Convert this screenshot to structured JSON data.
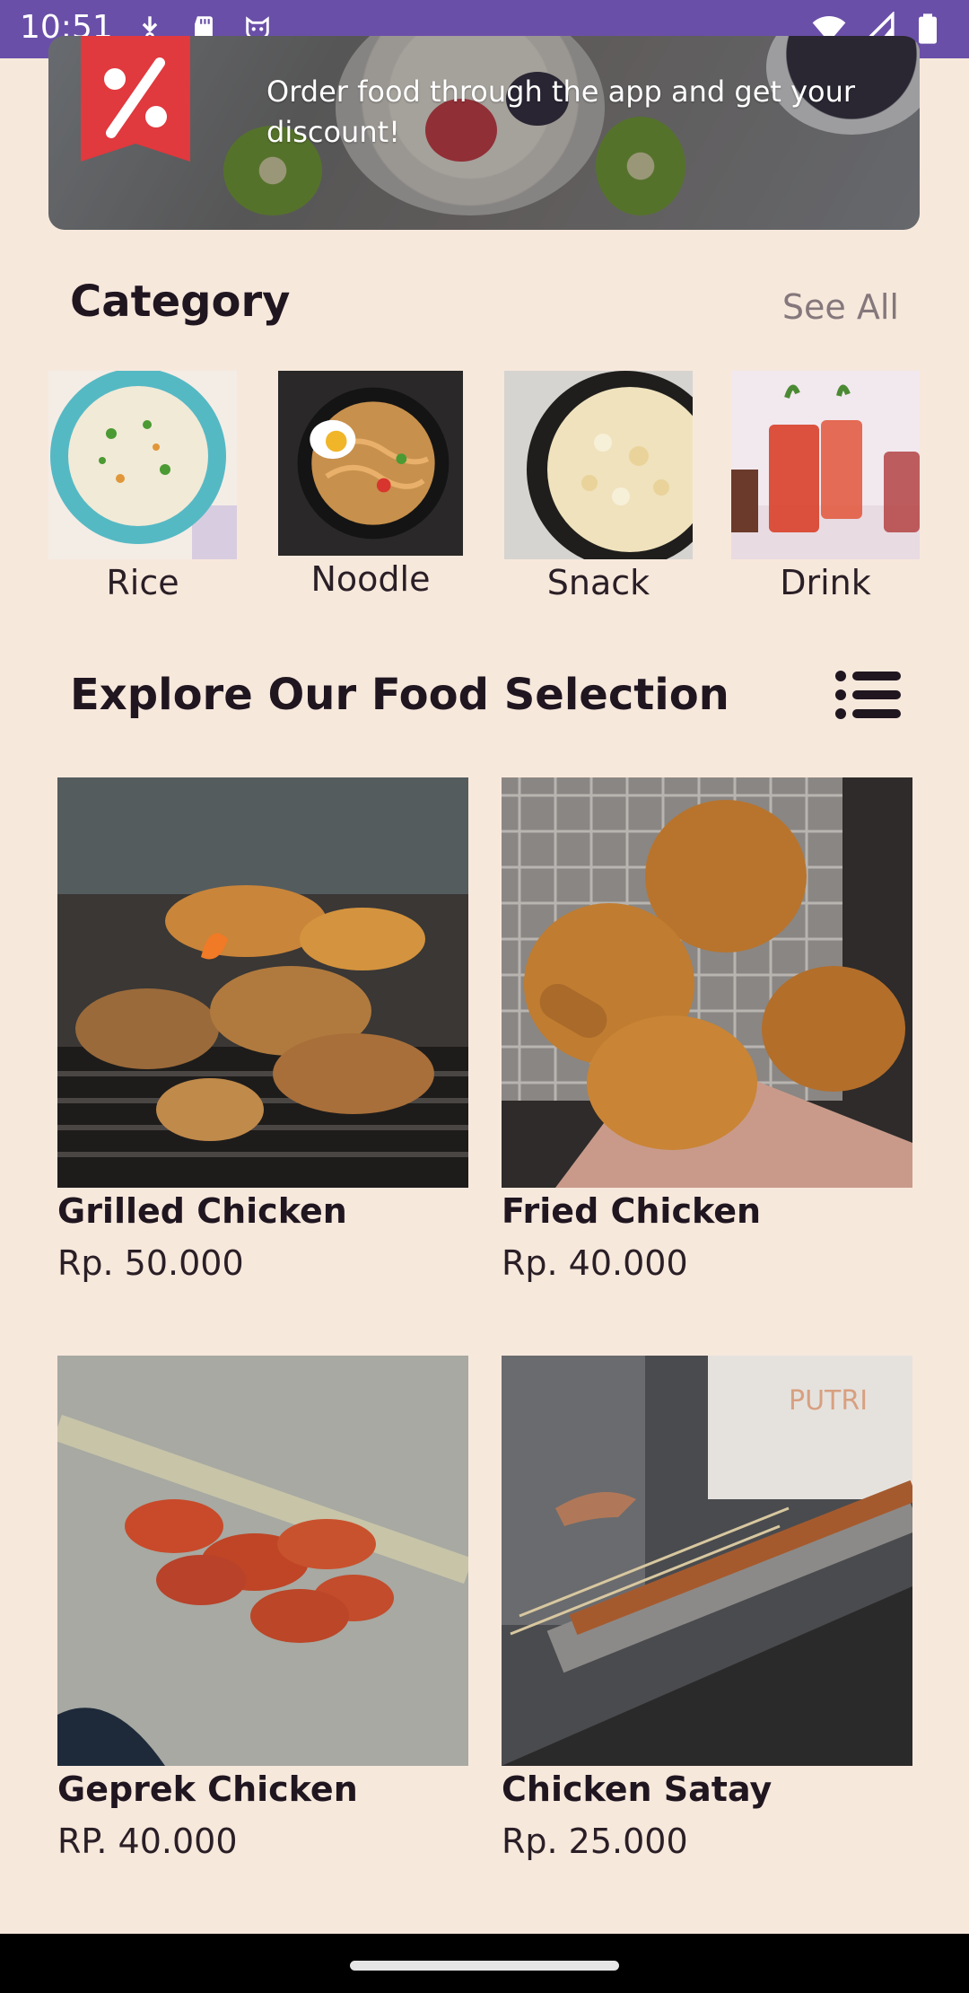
{
  "status_bar": {
    "time": "10:51",
    "icons": [
      "download-icon",
      "sd-card-icon",
      "cat-face-icon",
      "wifi-icon",
      "cellular-signal-icon",
      "battery-icon"
    ],
    "background": "#6a4fa8"
  },
  "banner": {
    "badge_icon": "percent-discount-icon",
    "text": "Order food through the app and get your discount!"
  },
  "category_section": {
    "title": "Category",
    "see_all": "See All",
    "items": [
      {
        "label": "Rice",
        "icon": "rice-image"
      },
      {
        "label": "Noodle",
        "icon": "noodle-image"
      },
      {
        "label": "Snack",
        "icon": "snack-image"
      },
      {
        "label": "Drink",
        "icon": "drink-image"
      }
    ]
  },
  "food_section": {
    "title": "Explore Our Food Selection",
    "view_toggle_icon": "list-view-icon",
    "items": [
      {
        "name": "Grilled Chicken",
        "price": "Rp. 50.000"
      },
      {
        "name": "Fried Chicken",
        "price": "Rp. 40.000"
      },
      {
        "name": "Geprek Chicken",
        "price": "RP. 40.000"
      },
      {
        "name": "Chicken Satay",
        "price": "Rp. 25.000"
      }
    ]
  },
  "colors": {
    "background": "#f7e8dc",
    "accent": "#6a4fa8",
    "discount_red": "#e0393e"
  }
}
